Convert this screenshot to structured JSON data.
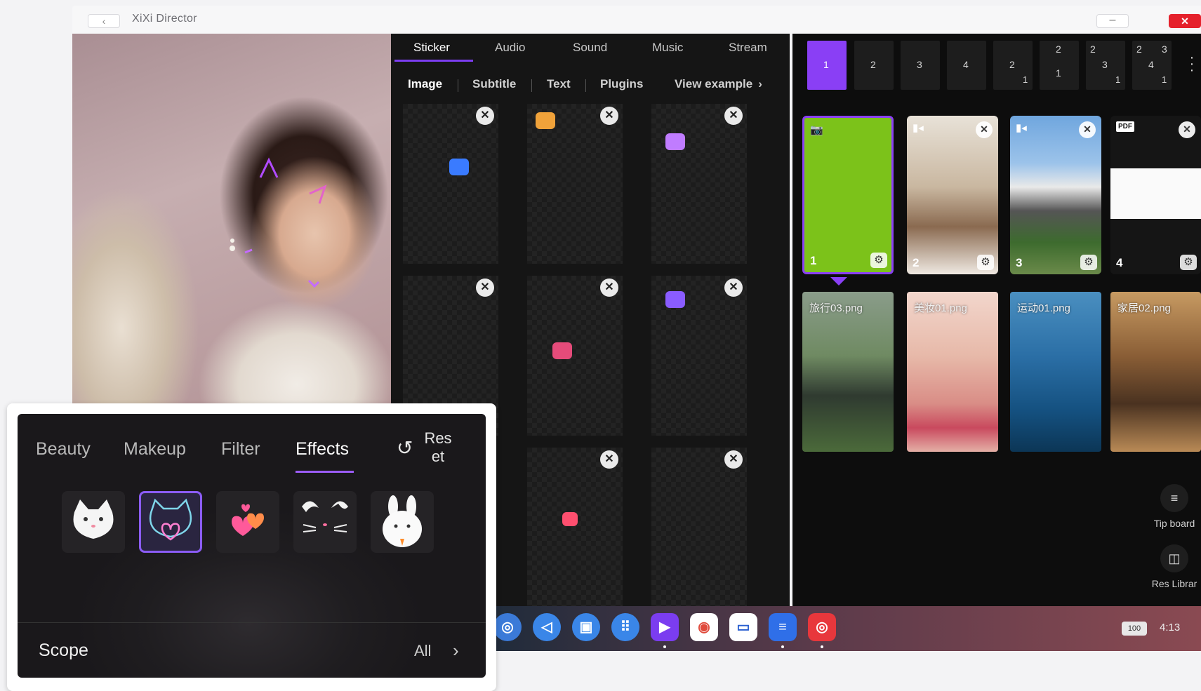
{
  "window": {
    "title": "XiXi Director",
    "back_icon": "chevron-left-icon",
    "min_icon": "minimize-icon",
    "close_icon": "close-icon"
  },
  "sticker_panel": {
    "tabs": [
      "Sticker",
      "Audio",
      "Sound",
      "Music",
      "Stream"
    ],
    "active_tab": "Sticker",
    "sub_tabs": [
      "Image",
      "Subtitle",
      "Text",
      "Plugins"
    ],
    "active_sub_tab": "Image",
    "view_example": "View example",
    "accent": "#7b3df0"
  },
  "layout_bar": {
    "buttons": [
      {
        "main": "1"
      },
      {
        "main": "2"
      },
      {
        "main": "3"
      },
      {
        "main": "4"
      },
      {
        "a": "2",
        "b": "1"
      },
      {
        "a": "2",
        "b": "1"
      },
      {
        "a": "2",
        "b": "3",
        "c": "1"
      },
      {
        "a": "2",
        "b": "3",
        "c": "4",
        "d": "1"
      }
    ],
    "active_index": 0
  },
  "sources": [
    {
      "num": "1",
      "type": "camera",
      "color": "#7cc21a"
    },
    {
      "num": "2",
      "type": "video"
    },
    {
      "num": "3",
      "type": "video"
    },
    {
      "num": "4",
      "type": "pdf",
      "badge": "PDF"
    }
  ],
  "media": [
    {
      "label": "旅行03.png"
    },
    {
      "label": "美妆01.png"
    },
    {
      "label": "运动01.png"
    },
    {
      "label": "家居02.png"
    }
  ],
  "side_tools": {
    "tip_board": "Tip board",
    "res_library": "Res Librar"
  },
  "taskbar": {
    "battery": "100",
    "time": "4:13"
  },
  "beauty": {
    "tabs": [
      "Beauty",
      "Makeup",
      "Filter",
      "Effects"
    ],
    "active_tab": "Effects",
    "reset": "Res et",
    "effects": [
      "cat-face-icon",
      "cat-heart-icon",
      "hearts-icon",
      "bunny-ears-icon",
      "bunny-icon"
    ],
    "selected_effect": 1,
    "scope_label": "Scope",
    "scope_value": "All"
  }
}
